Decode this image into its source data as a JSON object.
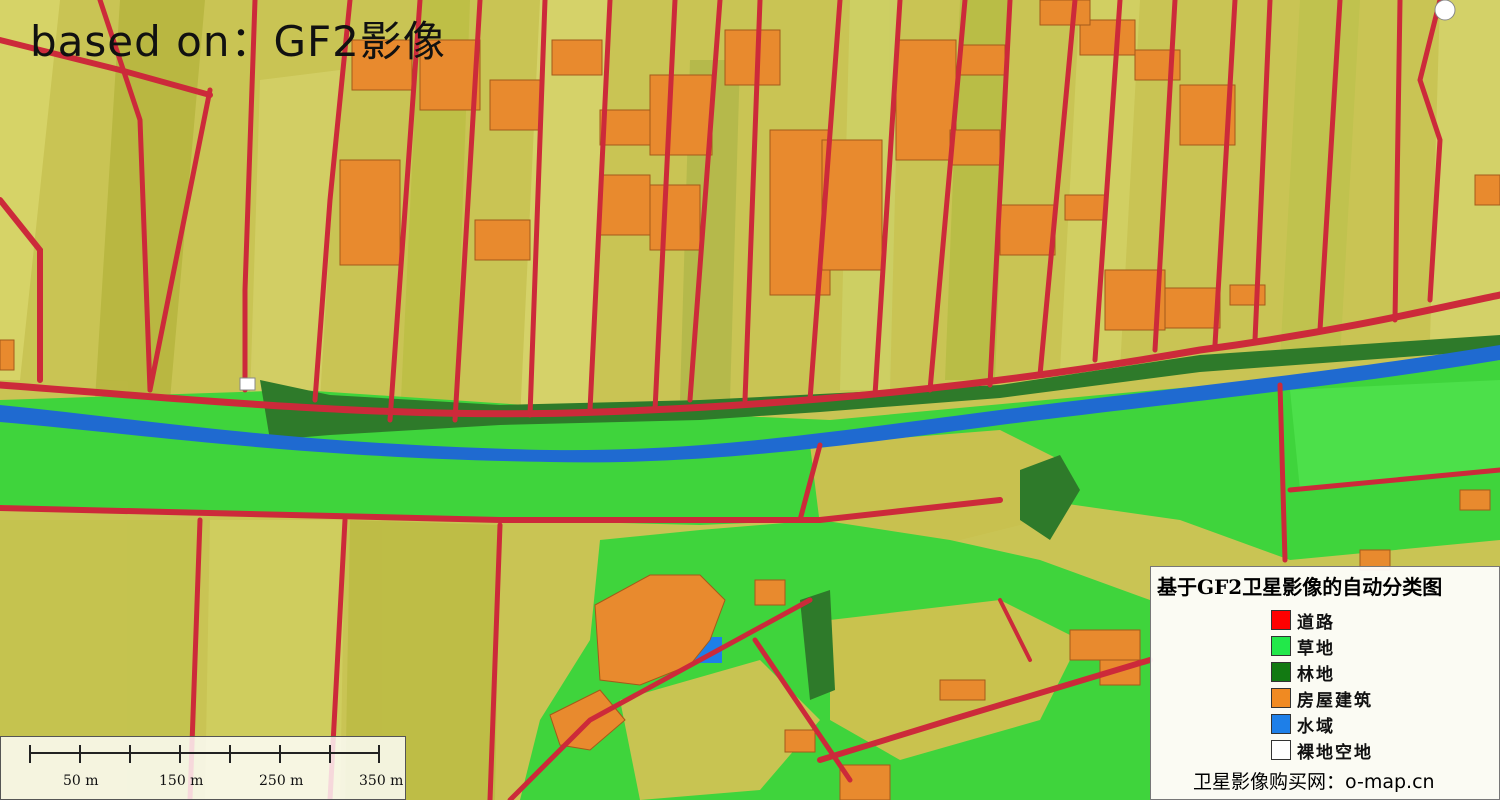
{
  "overlay_title": "based on：GF2影像",
  "legend": {
    "title": "基于GF2卫星影像的自动分类图",
    "items": [
      {
        "label": "道路",
        "color": "#ff0000"
      },
      {
        "label": "草地",
        "color": "#22e84a"
      },
      {
        "label": "林地",
        "color": "#127a12"
      },
      {
        "label": "房屋建筑",
        "color": "#f08a22"
      },
      {
        "label": "水域",
        "color": "#1e7fe8"
      },
      {
        "label": "裸地空地",
        "color": "#ffffff"
      }
    ],
    "footer": "卫星影像购买网：o-map.cn"
  },
  "scale_bar": {
    "labels": [
      "50 m",
      "150 m",
      "250 m",
      "350 m"
    ]
  },
  "map_colors": {
    "cropland": "#c9c454",
    "road": "#cc2a3a",
    "grass": "#3fd43c",
    "forest": "#2e7a2a",
    "building": "#e88a2e",
    "water": "#1f6ad0"
  }
}
